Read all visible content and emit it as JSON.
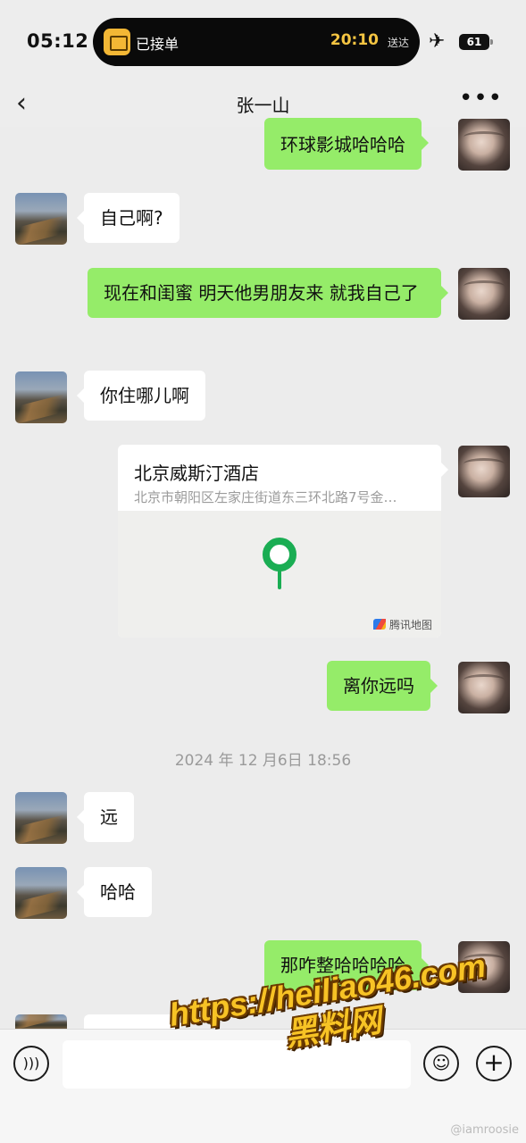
{
  "status_bar": {
    "time": "05:12",
    "island_label": "已接单",
    "island_eta": "20:10",
    "island_eta_suffix": "送达",
    "battery": "61",
    "icons": [
      "airplane-mode-icon",
      "battery-icon",
      "delivery-app-icon"
    ]
  },
  "header": {
    "back_icon": "‹",
    "title": "张一山",
    "more_icon": "•••"
  },
  "messages": [
    {
      "side": "out",
      "text": "环球影城哈哈哈"
    },
    {
      "side": "in",
      "text": "自己啊?"
    },
    {
      "side": "out",
      "text": "现在和闺蜜 明天他男朋友来 就我自己了"
    },
    {
      "side": "in",
      "text": "你住哪儿啊"
    },
    {
      "side": "out",
      "type": "location",
      "name": "北京威斯汀酒店",
      "address": "北京市朝阳区左家庄街道东三环北路7号金…",
      "map_brand": "腾讯地图"
    },
    {
      "side": "out",
      "text": "离你远吗"
    },
    {
      "side": "in",
      "text": "远"
    },
    {
      "side": "in",
      "text": "哈哈"
    },
    {
      "side": "out",
      "text": "那咋整哈哈哈哈"
    }
  ],
  "timestamp": "2024 年 12 月6日 18:56",
  "input_bar": {
    "voice_icon": "voice-icon",
    "emoji_icon": "emoji-icon",
    "plus_icon": "plus-icon",
    "placeholder": ""
  },
  "overlay": {
    "watermark_url": "https://heiliao46.com",
    "watermark_name": "黑料网",
    "weibo_handle": "@iamroosie"
  },
  "colors": {
    "background": "#ececec",
    "out_bubble": "#95ec69",
    "in_bubble": "#ffffff",
    "map_pin": "#1aad53",
    "watermark": "#f7c325"
  }
}
